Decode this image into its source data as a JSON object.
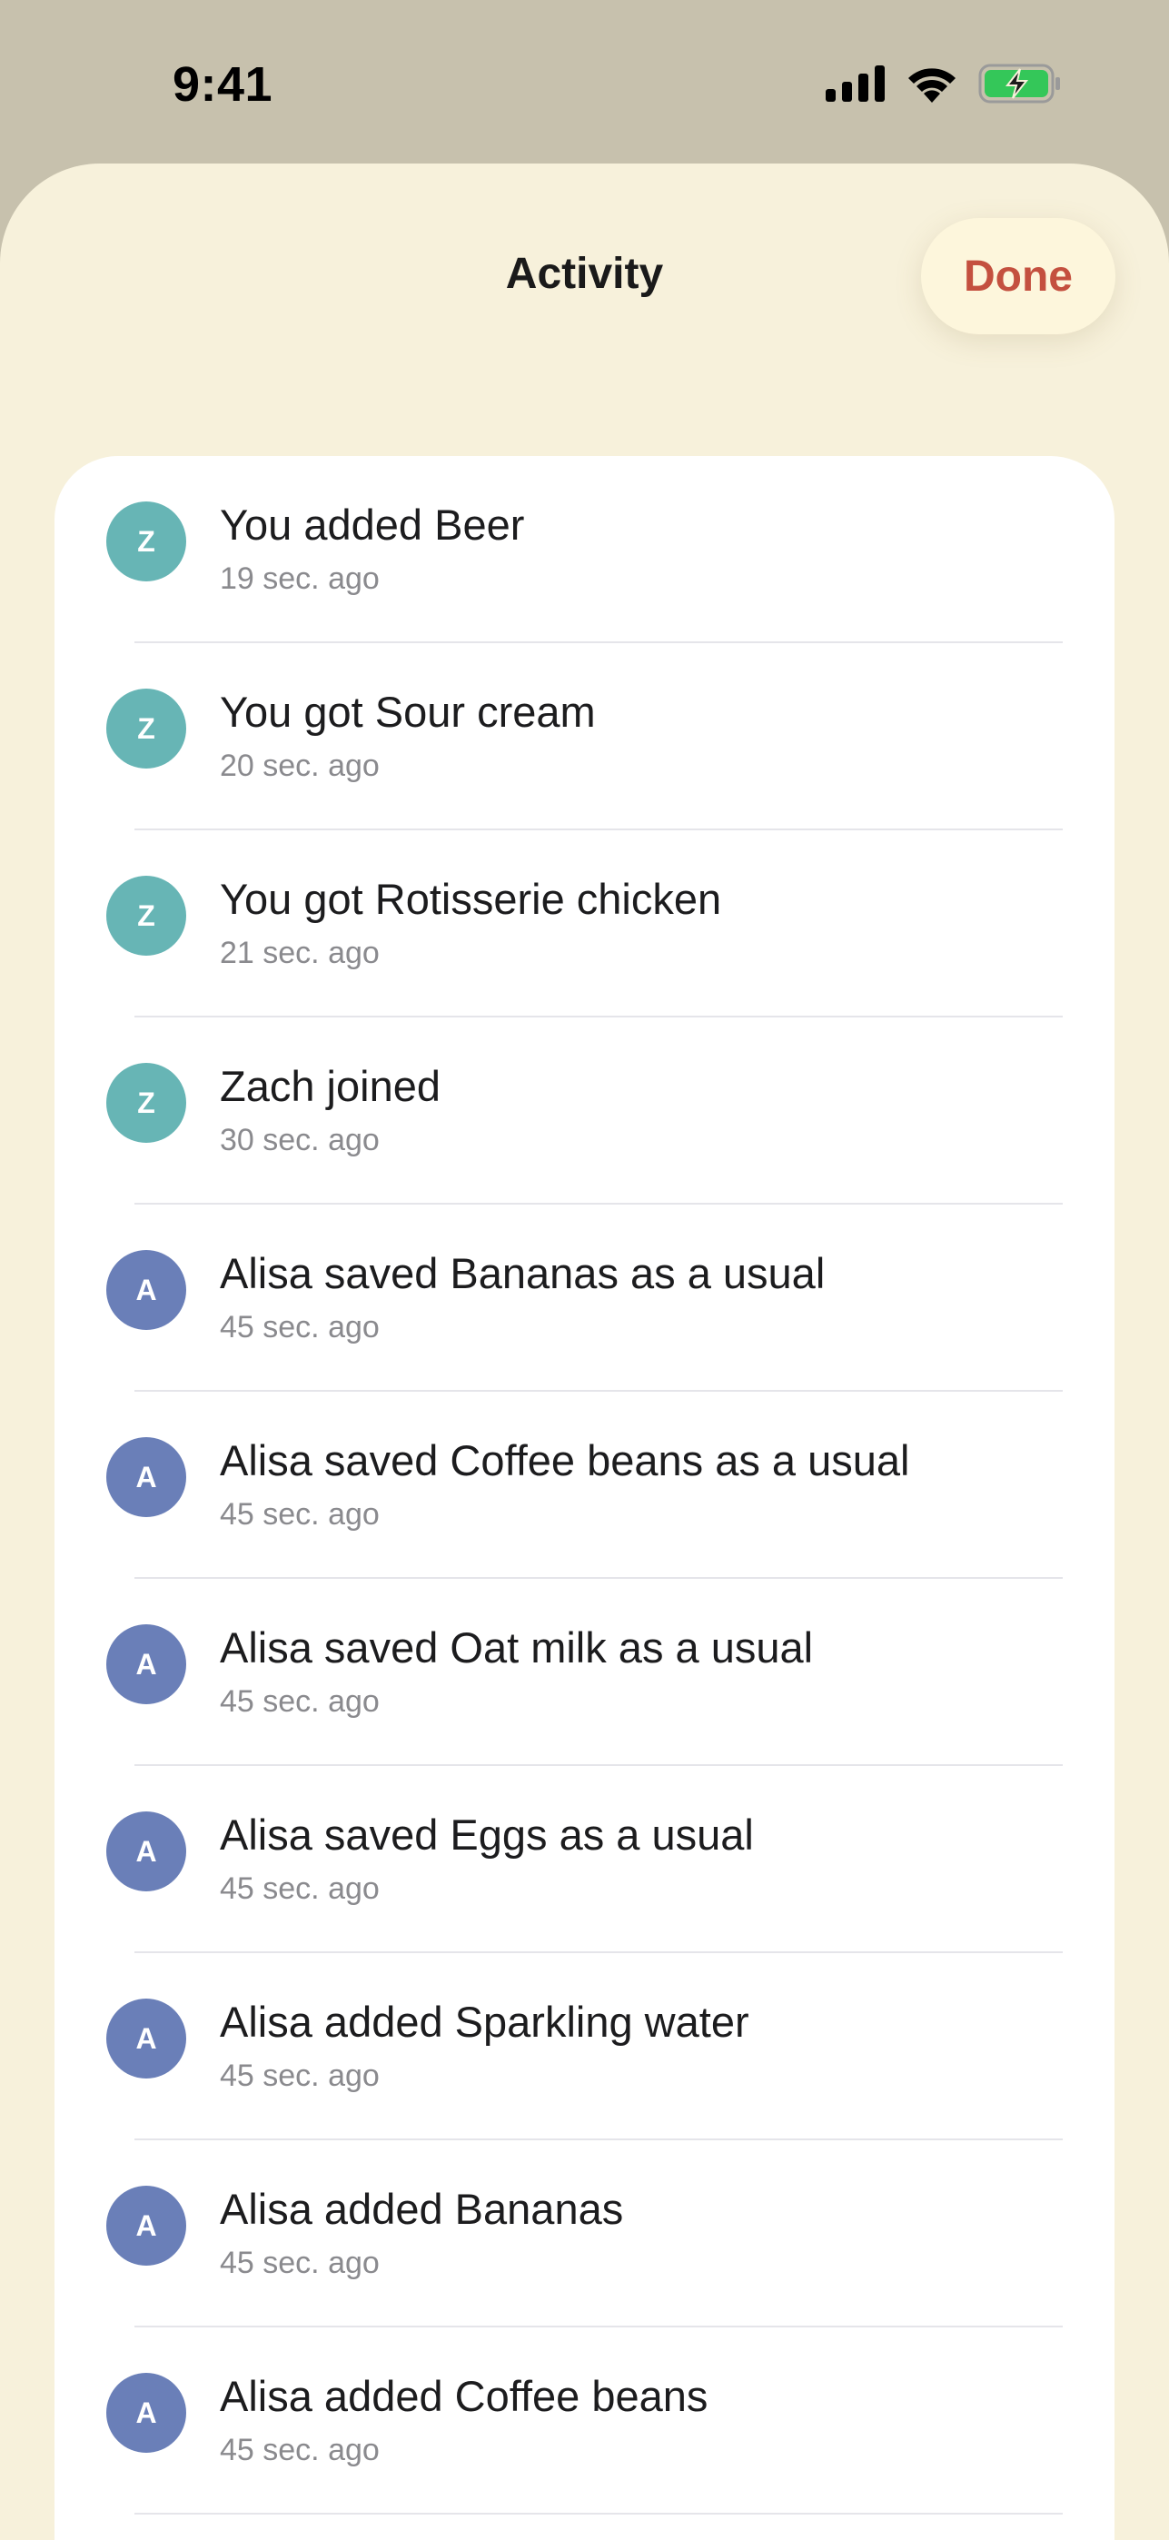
{
  "status_bar": {
    "time": "9:41",
    "battery_color": "#34c759"
  },
  "sheet": {
    "title": "Activity",
    "done_label": "Done",
    "accent_color": "#c4503f"
  },
  "avatar_colors": {
    "Z": "#67b5b5",
    "A": "#6a7fb8"
  },
  "activities": [
    {
      "initial": "Z",
      "text": "You added Beer",
      "time": "19 sec. ago"
    },
    {
      "initial": "Z",
      "text": "You got Sour cream",
      "time": "20 sec. ago"
    },
    {
      "initial": "Z",
      "text": "You got Rotisserie chicken",
      "time": "21 sec. ago"
    },
    {
      "initial": "Z",
      "text": "Zach joined",
      "time": "30 sec. ago"
    },
    {
      "initial": "A",
      "text": "Alisa saved Bananas as a usual",
      "time": "45 sec. ago"
    },
    {
      "initial": "A",
      "text": "Alisa saved Coffee beans as a usual",
      "time": "45 sec. ago"
    },
    {
      "initial": "A",
      "text": "Alisa saved Oat milk as a usual",
      "time": "45 sec. ago"
    },
    {
      "initial": "A",
      "text": "Alisa saved Eggs as a usual",
      "time": "45 sec. ago"
    },
    {
      "initial": "A",
      "text": "Alisa added Sparkling water",
      "time": "45 sec. ago"
    },
    {
      "initial": "A",
      "text": "Alisa added Bananas",
      "time": "45 sec. ago"
    },
    {
      "initial": "A",
      "text": "Alisa added Coffee beans",
      "time": "45 sec. ago"
    }
  ]
}
